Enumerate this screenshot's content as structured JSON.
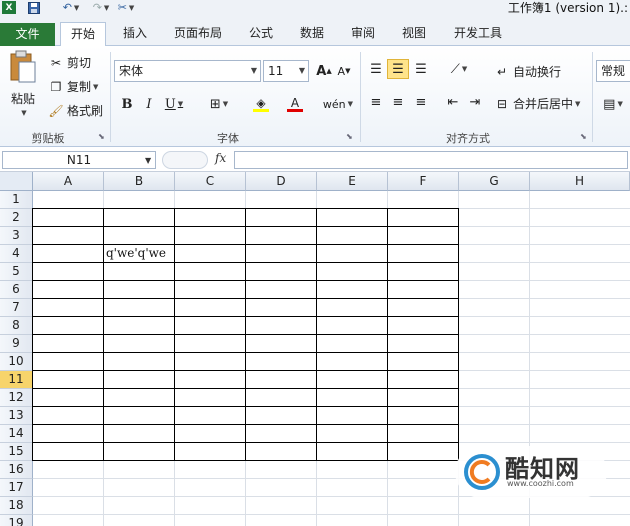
{
  "window": {
    "title": "工作簿1 (version 1).:"
  },
  "quick_access": [
    "excel-logo-icon",
    "save-icon",
    "undo-icon",
    "redo-icon",
    "customize-icon"
  ],
  "tabs": [
    {
      "id": "file",
      "label": "文件"
    },
    {
      "id": "home",
      "label": "开始"
    },
    {
      "id": "insert",
      "label": "插入"
    },
    {
      "id": "page_layout",
      "label": "页面布局"
    },
    {
      "id": "formulas",
      "label": "公式"
    },
    {
      "id": "data",
      "label": "数据"
    },
    {
      "id": "review",
      "label": "审阅"
    },
    {
      "id": "view",
      "label": "视图"
    },
    {
      "id": "developer",
      "label": "开发工具"
    }
  ],
  "ribbon": {
    "clipboard": {
      "label": "剪贴板",
      "paste": "粘贴",
      "cut": "剪切",
      "copy": "复制",
      "format_painter": "格式刷"
    },
    "font": {
      "label": "字体",
      "font_name": "宋体",
      "font_size": "11"
    },
    "alignment": {
      "label": "对齐方式",
      "wrap_text": "自动换行",
      "merge_center": "合并后居中"
    },
    "number": {
      "format": "常规"
    }
  },
  "formula_bar": {
    "name_box": "N11",
    "fx": "fx",
    "value": ""
  },
  "sheet": {
    "columns": [
      "A",
      "B",
      "C",
      "D",
      "E",
      "F",
      "G",
      "H"
    ],
    "rows": [
      "1",
      "2",
      "3",
      "4",
      "5",
      "6",
      "7",
      "8",
      "9",
      "10",
      "11",
      "12",
      "13",
      "14",
      "15",
      "16",
      "17",
      "18",
      "19"
    ],
    "active_row": "11",
    "cells": {
      "B4": "q'we'q'we"
    }
  },
  "watermark": {
    "name": "酷知网",
    "url": "www.coozhi.com"
  }
}
